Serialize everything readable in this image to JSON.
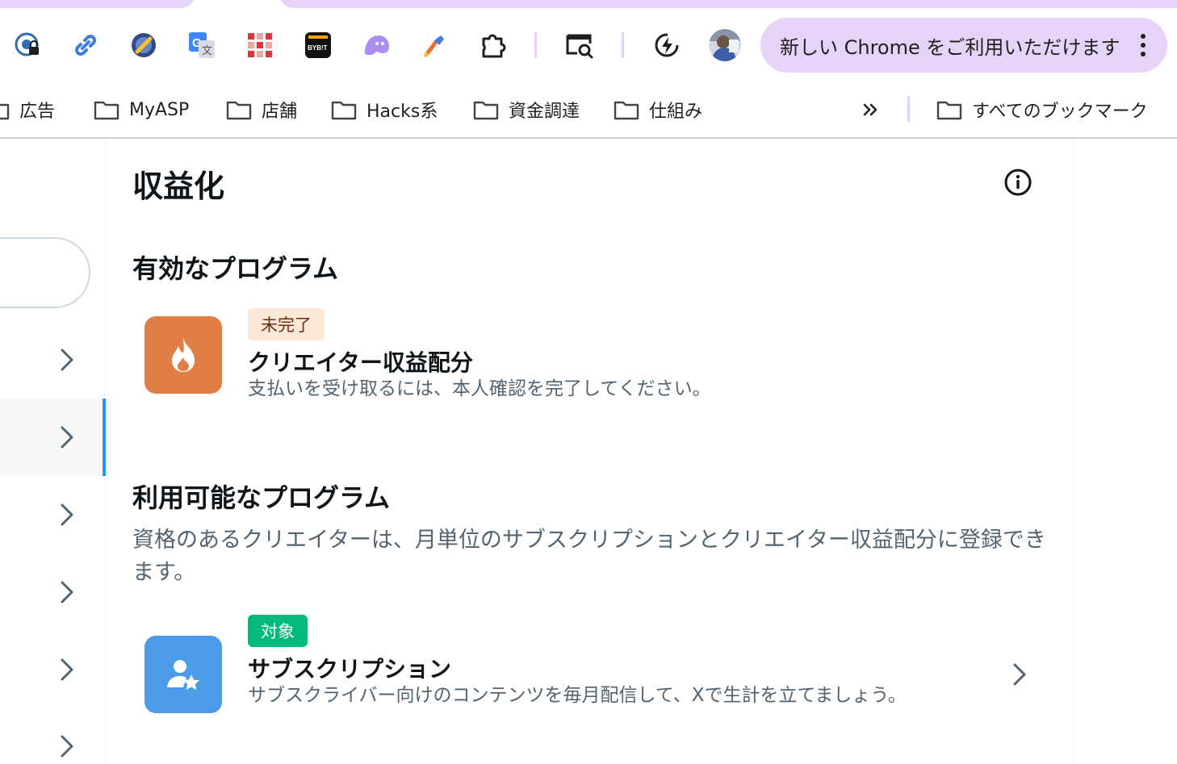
{
  "browser": {
    "update_banner": "新しい Chrome をご利用いただけます",
    "extensions": [
      {
        "icon": "password-lock-icon"
      },
      {
        "icon": "link-icon"
      },
      {
        "icon": "tag-globe-icon"
      },
      {
        "icon": "google-translate-icon"
      },
      {
        "icon": "grid-icon"
      },
      {
        "icon": "bybit-icon",
        "label": "BYB!T"
      },
      {
        "icon": "ghost-icon"
      },
      {
        "icon": "color-picker-icon"
      },
      {
        "icon": "extensions-puzzle-icon"
      },
      {
        "icon": "page-search-icon"
      },
      {
        "icon": "lightning-icon"
      },
      {
        "icon": "profile-avatar"
      }
    ],
    "bookmarks": [
      {
        "label": "広告"
      },
      {
        "label": "MyASP"
      },
      {
        "label": "店舗"
      },
      {
        "label": "Hacks系"
      },
      {
        "label": "資金調達"
      },
      {
        "label": "仕組み"
      }
    ],
    "all_bookmarks": "すべてのブックマーク",
    "colors": {
      "accent_pill": "#e5d4f7"
    }
  },
  "page": {
    "title": "収益化",
    "active_section": {
      "title": "有効なプログラム",
      "program": {
        "badge": "未完了",
        "name": "クリエイター収益配分",
        "description": "支払いを受け取るには、本人確認を完了してください。",
        "icon": "flame-icon",
        "icon_color": "#e07f45"
      }
    },
    "available_section": {
      "title": "利用可能なプログラム",
      "description": "資格のあるクリエイターは、月単位のサブスクリプションとクリエイター収益配分に登録できます。",
      "program": {
        "badge": "対象",
        "name": "サブスクリプション",
        "description": "サブスクライバー向けのコンテンツを毎月配信して、Xで生計を立てましょう。",
        "icon": "subscriber-star-icon",
        "icon_color": "#4c9be9"
      }
    }
  }
}
